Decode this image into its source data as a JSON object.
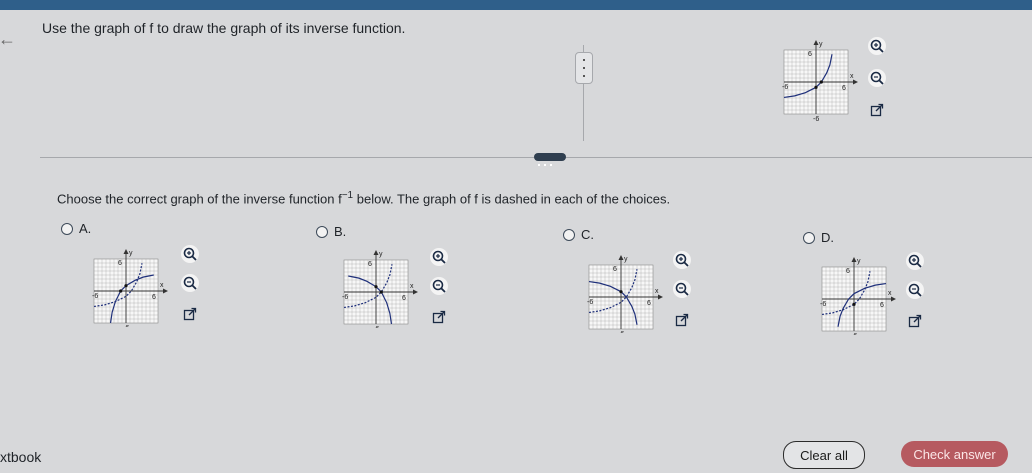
{
  "question": {
    "text": "Use the graph of f to draw the graph of its inverse function."
  },
  "instruction": {
    "part1": "Choose the correct graph of the inverse function f",
    "sup": "−1",
    "part2": " below. The graph of f is dashed in each of the choices."
  },
  "graph_labels": {
    "y": "y",
    "x": "x",
    "pos": "6",
    "neg": "-6"
  },
  "choices": [
    {
      "letter": "A."
    },
    {
      "letter": "B."
    },
    {
      "letter": "C."
    },
    {
      "letter": "D."
    }
  ],
  "footer": {
    "brand": "xtbook",
    "clear_label": "Clear all",
    "check_label": "Check answer"
  },
  "colors": {
    "accent": "#2f5f8a",
    "check": "#b65a60",
    "curve": "#1e2f7a"
  }
}
